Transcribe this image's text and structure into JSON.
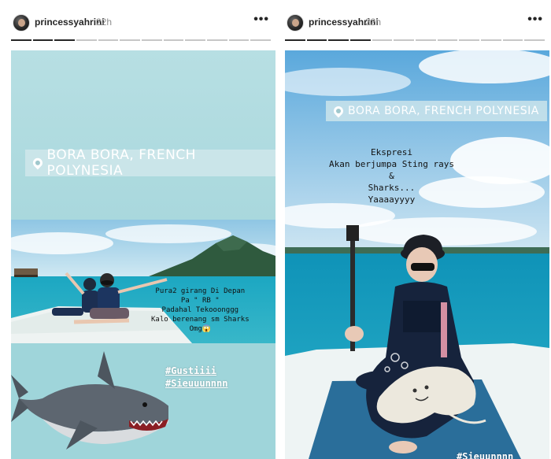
{
  "stories": [
    {
      "username": "princessyahrini",
      "time": "22h",
      "more": "•••",
      "progress": {
        "segments": 12,
        "active": 3
      },
      "location": "BORA BORA, FRENCH POLYNESIA",
      "caption": "Pura2 girang Di Depan\nPa \" RB \"\nPadahal Tekooonggg\nKalo berenang sm Sharks\nOmg😱",
      "hashtags": [
        "#Gustiiii",
        "#Sieuuunnnn"
      ]
    },
    {
      "username": "princessyahrini",
      "time": "22h",
      "more": "•••",
      "progress": {
        "segments": 12,
        "active": 4
      },
      "location": "BORA BORA, FRENCH POLYNESIA",
      "caption": "Ekspresi\nAkan berjumpa Sting rays\n&\nSharks...\nYaaaayyyy",
      "hashtags": [
        "#Sieuunnnn"
      ]
    }
  ],
  "colors": {
    "sky_light": "#b7dfe3",
    "sea": "#1aa6c4",
    "boat": "#e9f2f3",
    "progress_active": "#262626",
    "progress_inactive": "#c7c7c7"
  },
  "icons": {
    "location": "map-pin-icon",
    "more": "more-options-icon",
    "shark": "shark-sticker",
    "stingray": "stingray-sticker"
  }
}
